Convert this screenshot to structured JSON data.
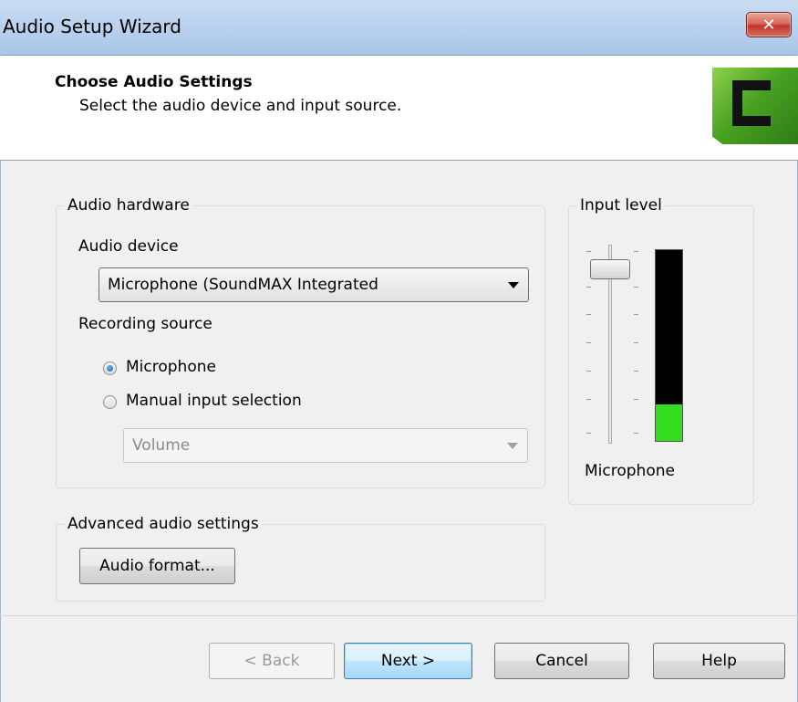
{
  "window": {
    "title": "Audio Setup Wizard",
    "close_label": "✕"
  },
  "header": {
    "title": "Choose Audio Settings",
    "subtitle": "Select the audio device and input source."
  },
  "audio_hardware": {
    "legend": "Audio hardware",
    "device_label": "Audio device",
    "device_value": "Microphone (SoundMAX Integrated",
    "source_label": "Recording source",
    "radio_microphone": "Microphone",
    "radio_manual": "Manual input selection",
    "selected_source": "Microphone",
    "input_select_value": "Volume"
  },
  "input_level": {
    "legend": "Input level",
    "caption": "Microphone",
    "meter_level": 0.19,
    "slider_level": 0.9
  },
  "advanced": {
    "legend": "Advanced audio settings",
    "format_button": "Audio format..."
  },
  "buttons": {
    "back": "< Back",
    "next": "Next >",
    "cancel": "Cancel",
    "help": "Help"
  },
  "colors": {
    "meter_fill": "#33dd20",
    "titlebar": "#bcd3ee",
    "close": "#c4352a"
  }
}
